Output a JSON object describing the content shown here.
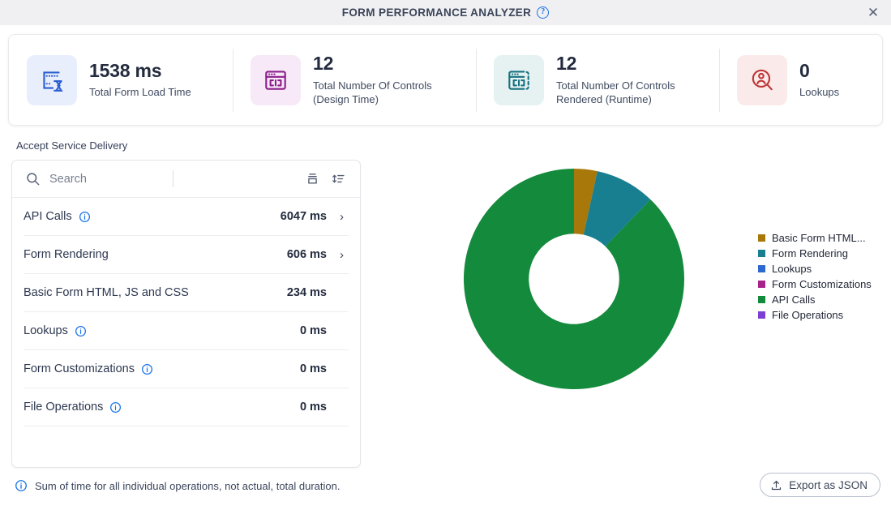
{
  "window": {
    "title": "FORM PERFORMANCE ANALYZER",
    "help_icon": "help-circle-icon",
    "close_icon": "close-icon"
  },
  "stats": [
    {
      "value": "1538 ms",
      "label": "Total Form Load Time",
      "icon": "form-load-time-icon",
      "icon_color": "#2b5fd0",
      "icon_bg": "#e8eefc"
    },
    {
      "value": "12",
      "label": "Total Number Of Controls (Design Time)",
      "icon": "controls-design-time-icon",
      "icon_color": "#8c1f8c",
      "icon_bg": "#f7e9f7"
    },
    {
      "value": "12",
      "label": "Total Number Of Controls Rendered (Runtime)",
      "icon": "controls-runtime-icon",
      "icon_color": "#16717f",
      "icon_bg": "#e6f2f2"
    },
    {
      "value": "0",
      "label": "Lookups",
      "icon": "lookups-icon",
      "icon_color": "#bf3434",
      "icon_bg": "#fbeaea"
    }
  ],
  "section": {
    "title": "Accept Service Delivery"
  },
  "search": {
    "placeholder": "Search",
    "value": "",
    "search_icon": "search-icon",
    "collapse_icon": "collapse-all-icon",
    "sort_icon": "sort-icon"
  },
  "breakdown": {
    "rows": [
      {
        "label": "API Calls",
        "value": "6047 ms",
        "has_info": true,
        "has_chevron": true
      },
      {
        "label": "Form Rendering",
        "value": "606 ms",
        "has_info": false,
        "has_chevron": true
      },
      {
        "label": "Basic Form HTML, JS and CSS",
        "value": "234 ms",
        "has_info": false,
        "has_chevron": false
      },
      {
        "label": "Lookups",
        "value": "0 ms",
        "has_info": true,
        "has_chevron": false
      },
      {
        "label": "Form Customizations",
        "value": "0 ms",
        "has_info": true,
        "has_chevron": false
      },
      {
        "label": "File Operations",
        "value": "0 ms",
        "has_info": true,
        "has_chevron": false
      }
    ]
  },
  "chart_data": {
    "type": "pie",
    "variant": "donut",
    "title": "",
    "categories": [
      "Basic Form HTML...",
      "Form Rendering",
      "Lookups",
      "Form Customizations",
      "API Calls",
      "File Operations"
    ],
    "values": [
      234,
      606,
      0,
      0,
      6047,
      0
    ],
    "unit": "ms",
    "total": 6887,
    "colors": [
      "#a8780a",
      "#187f90",
      "#2c68cf",
      "#a8228c",
      "#138a3c",
      "#7b3fd4"
    ],
    "start_angle": 0,
    "inner_radius_ratio": 0.41,
    "legend_position": "right"
  },
  "footer": {
    "note": "Sum of time for all individual operations, not actual, total duration.",
    "note_icon": "info-icon",
    "export_label": "Export as JSON",
    "export_icon": "upload-icon"
  }
}
